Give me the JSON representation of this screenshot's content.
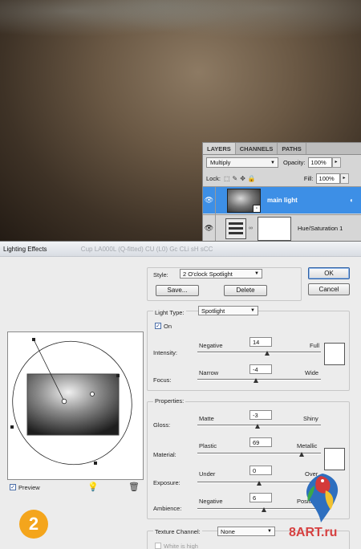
{
  "layers_panel": {
    "tabs": [
      "LAYERS",
      "CHANNELS",
      "PATHS"
    ],
    "blend_mode": "Multiply",
    "opacity_label": "Opacity:",
    "opacity_value": "100%",
    "lock_label": "Lock:",
    "fill_label": "Fill:",
    "fill_value": "100%",
    "layers": [
      {
        "name": "main light",
        "selected": true
      },
      {
        "name": "Hue/Saturation 1",
        "selected": false
      }
    ]
  },
  "dialog": {
    "title": "Lighting Effects",
    "ghost_title": "Cup LA000L (Q-fitted) CU (L0) Gc CLi sH sCC",
    "style_label": "Style:",
    "style_value": "2 O'clock Spotlight",
    "save_label": "Save...",
    "delete_label": "Delete",
    "ok_label": "OK",
    "cancel_label": "Cancel",
    "light_type_label": "Light Type:",
    "light_type_value": "Spotlight",
    "on_label": "On",
    "intensity_label": "Intensity:",
    "intensity_min": "Negative",
    "intensity_max": "Full",
    "intensity_value": "14",
    "focus_label": "Focus:",
    "focus_min": "Narrow",
    "focus_max": "Wide",
    "focus_value": "-4",
    "properties_label": "Properties:",
    "gloss_label": "Gloss:",
    "gloss_min": "Matte",
    "gloss_max": "Shiny",
    "gloss_value": "-3",
    "material_label": "Material:",
    "material_min": "Plastic",
    "material_max": "Metallic",
    "material_value": "69",
    "exposure_label": "Exposure:",
    "exposure_min": "Under",
    "exposure_max": "Over",
    "exposure_value": "0",
    "ambience_label": "Ambience:",
    "ambience_min": "Negative",
    "ambience_max": "Positive",
    "ambience_value": "6",
    "texture_channel_label": "Texture Channel:",
    "texture_channel_value": "None",
    "white_is_high_label": "White is high",
    "preview_label": "Preview"
  },
  "step_badge": "2",
  "watermark": "8ART.ru",
  "colors": {
    "selection_blue": "#3d8fe6",
    "badge_orange": "#f4a51c"
  }
}
